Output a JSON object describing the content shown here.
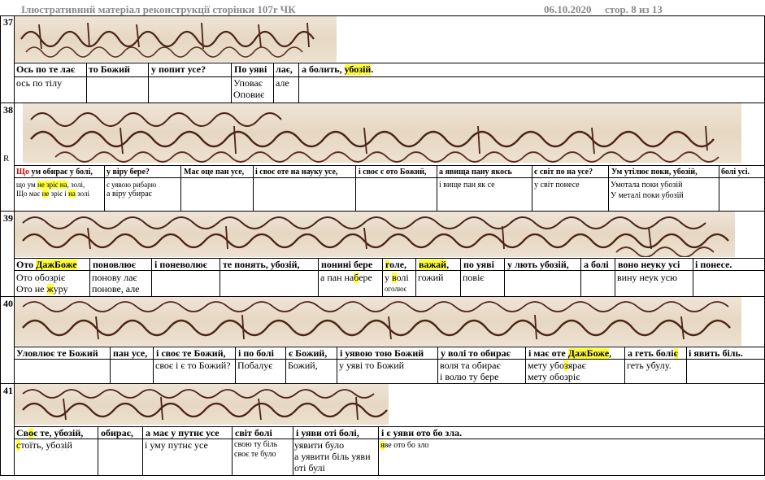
{
  "header": {
    "title": "Ілюстративний матеріал  реконструкції сторінки 107r ЧК",
    "date": "06.10.2020",
    "page": "стор. 8 из 13"
  },
  "lines": [
    {
      "number": "37",
      "top_cells": [
        "Ось по те лає",
        "то Божий",
        "у попит усе?",
        "По уяві",
        "лає,",
        "а болить, ",
        "убозій",
        "."
      ],
      "bottom_cells": [
        "ось по тілу",
        "Уповає",
        "Оповиє",
        "але"
      ]
    },
    {
      "number": "38",
      "marker": "R",
      "top_cells": [
        "Що",
        " ум обирає у болі,",
        "у віру бере?",
        "Має оце пан усе,",
        "і своє оте на науку усе,",
        "і своє є ото Божий,",
        "а явища пану якось",
        "є світ по на усе?",
        "Ум утілює поки, ",
        "убозій,",
        "болі усі."
      ],
      "bottom_cells": [
        "що ум ",
        "не зріє на",
        ", золі,",
        "Що має ",
        "не",
        " зріє і ",
        "на",
        " золі",
        "є уявою рибарю",
        "а віру убирає",
        "і вище пан як се",
        "у світ понесе",
        "Умотала поки ",
        "убозій",
        "У металі поки ",
        "убозій"
      ]
    },
    {
      "number": "39",
      "top_cells": [
        "Ото ",
        "ДажБоже",
        "поновлює",
        "і поневолює",
        "те понять, убозій,",
        "понині бере",
        "г",
        "оле,",
        "важай",
        ",",
        "по уяві",
        "у лють убозій,",
        "а болі",
        "воно неуку усі",
        "і понесе."
      ],
      "bottom_cells": [
        "Ото ",
        "обозріє",
        "Ото не ",
        "ж",
        "уру",
        "понову лає",
        "понове, але",
        "а пан на",
        "б",
        "ере",
        "у ",
        "в",
        "олі",
        "оголює",
        "гожий",
        "повіє",
        "вину неук усю"
      ]
    },
    {
      "number": "40",
      "top_cells": [
        "Уловлює те Божий",
        "пан усе,",
        "і своє те Божий,",
        "і по болі",
        "є Божий,",
        "і уявою тою Божий",
        "у волі то обирає",
        "і має оте ",
        "ДажБоже",
        ",",
        "а геть болі",
        "є",
        "і явить біль."
      ],
      "bottom_cells": [
        "своє і є то Божий?",
        "Побалує",
        "Божий,",
        "у уяві то Божий",
        "воля та обирає",
        "і волю ту бере",
        "мету ",
        "убо",
        "з",
        "я",
        "рає",
        "мету ",
        "обозріє",
        "геть ",
        "убулу",
        "."
      ]
    },
    {
      "number": "41",
      "top_cells": [
        "Св",
        "о",
        "є те, ",
        "убозій,",
        "обирає,",
        "а має у путнє усе",
        "світ болі",
        "і уяви оті болі,",
        "і є уяви ото бо зла."
      ],
      "bottom_cells": [
        "с",
        "тоїть, ",
        "убозій",
        "і уму путнє усе",
        "свою ту біль",
        "своє те було",
        "уявити було",
        "а уявити біль уяви",
        "оті булі",
        "я",
        "ве ото бо зло"
      ]
    }
  ]
}
